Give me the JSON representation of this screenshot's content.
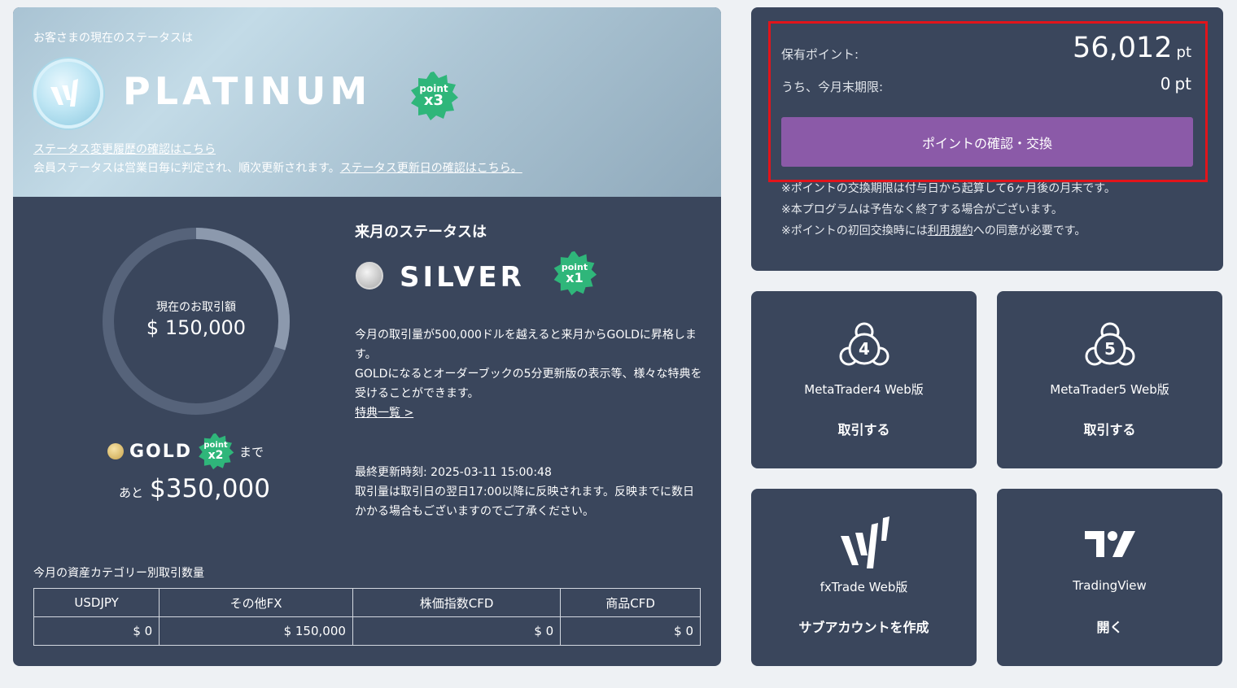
{
  "status": {
    "caption": "お客さまの現在のステータスは",
    "tier": "PLATINUM",
    "badge": {
      "word": "point",
      "mult": "x3"
    },
    "history_link": "ステータス変更履歴の確認はこちら",
    "note": "会員ステータスは営業日毎に判定され、順次更新されます。",
    "update_link": "ステータス更新日の確認はこちら。"
  },
  "current": {
    "label": "現在のお取引額",
    "amount": "$ 150,000",
    "progress_fraction": 0.3
  },
  "goal": {
    "tier": "GOLD",
    "badge": {
      "word": "point",
      "mult": "x2"
    },
    "made": "まで",
    "remain_prefix": "あと",
    "remain_amount": "$350,000"
  },
  "next": {
    "title": "来月のステータスは",
    "tier": "SILVER",
    "badge": {
      "word": "point",
      "mult": "x1"
    },
    "desc1": "今月の取引量が500,000ドルを越えると来月からGOLDに昇格します。",
    "desc2": "GOLDになるとオーダーブックの5分更新版の表示等、様々な特典を受けることができます。",
    "benefits_link": "特典一覧 >"
  },
  "update": {
    "last_updated": "最終更新時刻: 2025-03-11 15:00:48",
    "note": "取引量は取引日の翌日17:00以降に反映されます。反映までに数日かかる場合もございますのでご了承ください。"
  },
  "categories": {
    "title": "今月の資産カテゴリー別取引数量",
    "headers": [
      "USDJPY",
      "その他FX",
      "株価指数CFD",
      "商品CFD"
    ],
    "values": [
      "$ 0",
      "$ 150,000",
      "$ 0",
      "$ 0"
    ]
  },
  "points": {
    "held_label": "保有ポイント:",
    "held_value": "56,012",
    "unit": "pt",
    "expiring_label": "うち、今月末期限:",
    "expiring_value": "0",
    "button": "ポイントの確認・交換",
    "note1": "※ポイントの交換期限は付与日から起算して6ヶ月後の月末です。",
    "note2": "※本プログラムは予告なく終了する場合がございます。",
    "note3_pre": "※ポイントの初回交換時には",
    "note3_link": "利用規約",
    "note3_post": "への同意が必要です。",
    "highlight_color": "#e2141b"
  },
  "tiles": [
    {
      "name": "MetaTrader4 Web版",
      "action": "取引する",
      "icon": "metatrader4-icon",
      "glyph": "4"
    },
    {
      "name": "MetaTrader5 Web版",
      "action": "取引する",
      "icon": "metatrader5-icon",
      "glyph": "5"
    },
    {
      "name": "fxTrade Web版",
      "action": "サブアカウントを作成",
      "icon": "fxtrade-logo-icon"
    },
    {
      "name": "TradingView",
      "action": "開く",
      "icon": "tradingview-logo-icon"
    }
  ],
  "colors": {
    "card": "#3a465c",
    "accent_button": "#8b5aa8",
    "badge_green": "#2fb67a"
  }
}
